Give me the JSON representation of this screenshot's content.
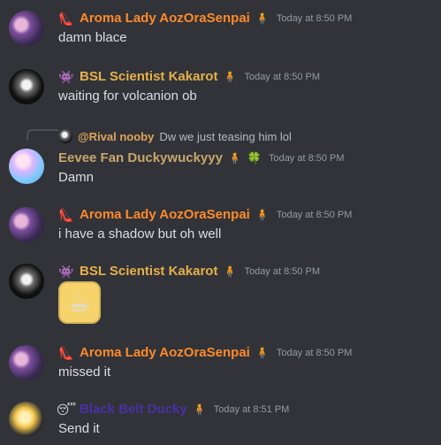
{
  "colors": {
    "background": "#313338",
    "text": "#dbdee1",
    "timestamp": "#949ba4",
    "aroma_name": "#ff8a2a",
    "kakarot_name": "#e6b04b",
    "eevee_name": "#c9a66b",
    "black_belt_name": "#4b2fa6",
    "reply_name": "#e0a55a"
  },
  "messages": [
    {
      "author": "Aroma Lady AozOraSenpai",
      "role_icon": "high-heel-icon",
      "badge_icon": "pink-figure-icon",
      "timestamp": "Today at 8:50 PM",
      "text": "damn blace"
    },
    {
      "author": "BSL Scientist Kakarot",
      "role_icon": "alien-monster-icon",
      "badge_icon": "gold-person-icon",
      "timestamp": "Today at 8:50 PM",
      "text": "waiting for volcanion ob"
    },
    {
      "reply": {
        "name": "@Rival nooby",
        "text": "Dw we just teasing him lol"
      },
      "author": "Eevee Fan Duckywuckyyy",
      "role_icon": "",
      "badge_icon": "gold-person-icon",
      "badge_icon_2": "green-clover-icon",
      "timestamp": "Today at 8:50 PM",
      "text": "Damn"
    },
    {
      "author": "Aroma Lady AozOraSenpai",
      "role_icon": "high-heel-icon",
      "badge_icon": "pink-figure-icon",
      "timestamp": "Today at 8:50 PM",
      "text": "i have a shadow but oh well"
    },
    {
      "author": "BSL Scientist Kakarot",
      "role_icon": "alien-monster-icon",
      "badge_icon": "gold-person-icon",
      "timestamp": "Today at 8:50 PM",
      "sticker_icon": "pokemon-sticker-icon"
    },
    {
      "author": "Aroma Lady AozOraSenpai",
      "role_icon": "high-heel-icon",
      "badge_icon": "pink-figure-icon",
      "timestamp": "Today at 8:50 PM",
      "text": "missed it"
    },
    {
      "author": "Black Belt Ducky",
      "role_icon": "sleepy-face-icon",
      "badge_icon": "brown-figure-icon",
      "timestamp": "Today at 8:51 PM",
      "text": "Send it"
    }
  ]
}
